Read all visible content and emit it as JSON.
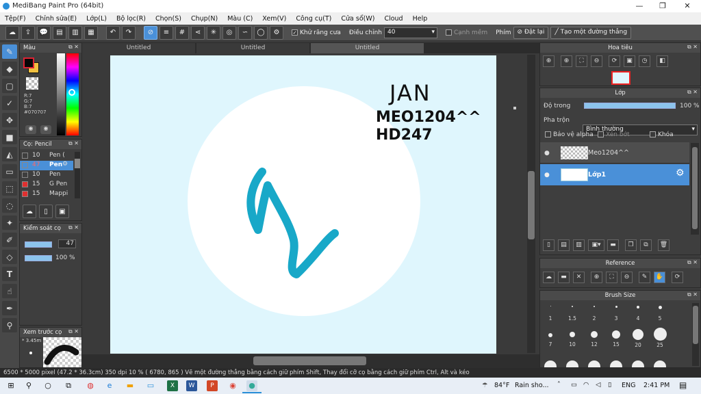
{
  "window": {
    "title": "MediBang Paint Pro (64bit)"
  },
  "menu": [
    "Tệp(F)",
    "Chỉnh sửa(E)",
    "Lớp(L)",
    "Bộ lọc(R)",
    "Chọn(S)",
    "Chụp(N)",
    "Màu (C)",
    "Xem(V)",
    "Công cụ(T)",
    "Cửa sổ(W)",
    "Cloud",
    "Help"
  ],
  "toolbar": {
    "antialias_label": "Khử răng cưa",
    "correction_label": "Điều chỉnh",
    "correction_value": "40",
    "soft_edge_label": "Cạnh mềm",
    "key_label": "Phím",
    "reset_label": "Đặt lại",
    "straight_label": "Tạo một đường thẳng"
  },
  "color_panel": {
    "title": "Màu",
    "r": "R:7",
    "g": "G:7",
    "b": "B:7",
    "hex": "#070707"
  },
  "brush_panel": {
    "title": "Cọ: Pencil",
    "items": [
      {
        "size": "10",
        "name": "Pen (",
        "color": "#222222"
      },
      {
        "size": "47",
        "name": "Pen",
        "color": "#222222"
      },
      {
        "size": "10",
        "name": "Pen",
        "color": "#222222"
      },
      {
        "size": "15",
        "name": "G Pen",
        "color": "#e03030"
      },
      {
        "size": "15",
        "name": "Mappi",
        "color": "#e03030"
      }
    ]
  },
  "brush_control": {
    "title": "Kiểm soát cọ",
    "size": "47",
    "opacity": "100 %"
  },
  "brush_preview": {
    "title": "Xem trước cọ",
    "size_text": "3.45m"
  },
  "tabs": [
    "Untitled",
    "Untitled",
    "Untitled"
  ],
  "navigator": {
    "title": "Hoa tiêu"
  },
  "layer_panel": {
    "title": "Lớp",
    "opacity_label": "Độ trong",
    "opacity_value": "100 %",
    "opacity": 1.0,
    "blend_label": "Pha trộn",
    "blend_value": "Bình thường",
    "protect_alpha": "Bảo vệ alpha",
    "clipping": "Xén bớt",
    "lock": "Khóa",
    "layers": [
      {
        "name": "Meo1204^^",
        "selected": false
      },
      {
        "name": "Lớp1",
        "selected": true
      }
    ]
  },
  "reference_panel": {
    "title": "Reference"
  },
  "brush_size_panel": {
    "title": "Brush Size",
    "row1": [
      "1",
      "1.5",
      "2",
      "3",
      "4",
      "5"
    ],
    "row2": [
      "7",
      "10",
      "12",
      "15",
      "20",
      "25"
    ]
  },
  "canvas_text": {
    "line1": "JAN",
    "line2": "MEO1204^^",
    "line3": "HD247"
  },
  "status": {
    "text": "6500 * 5000 pixel   (47.2 * 36.3cm)   350 dpi   10 %   ( 6780, 865 )   Vẽ một đường thẳng bằng cách giữ phím Shift, Thay đổi cỡ cọ bằng cách giữ phím Ctrl, Alt và kéo"
  },
  "taskbar": {
    "weather_temp": "84°F",
    "weather_desc": "Rain sho...",
    "lang": "ENG",
    "time": "2:41 PM"
  },
  "colors": {
    "accent": "#4a90d8",
    "stroke": "#18a8c8",
    "canvas_bg": "#dff6fd"
  }
}
